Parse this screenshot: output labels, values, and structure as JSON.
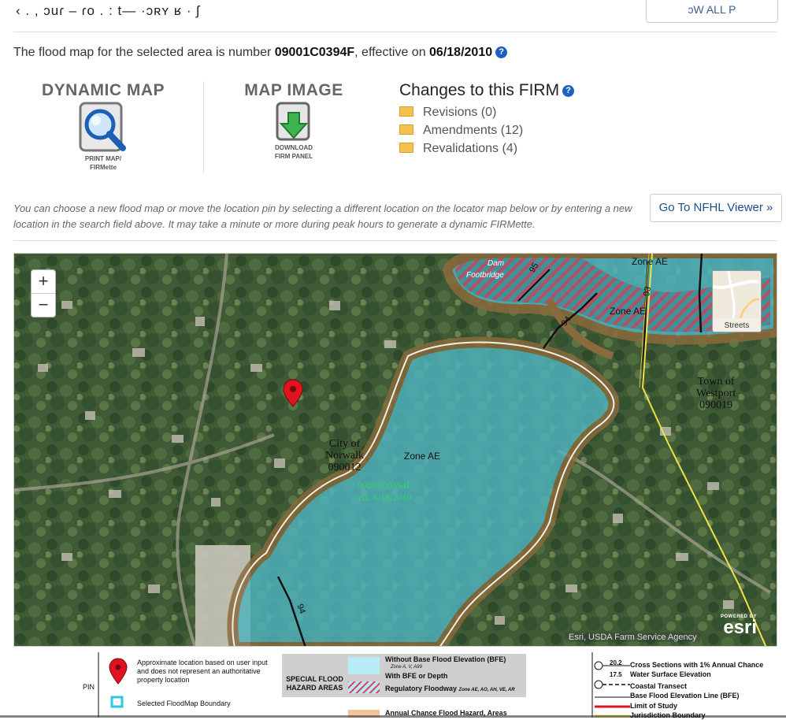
{
  "header": {
    "garbled_text": "‹ . , ɔuɾ ‒ ɾo . : t— ·ɔʀʏ ʁ · ʃ",
    "show_all_label": "ɔW ALL P"
  },
  "intro": {
    "prefix": "The flood map for the selected area is number ",
    "panel_number": "09001C0394F",
    "middle": ", effective on ",
    "effective_date": "06/18/2010",
    "help": "?"
  },
  "tools": {
    "dynamic_map": {
      "title": "DYNAMIC MAP",
      "caption_line1": "PRINT MAP/",
      "caption_line2": "FIRMette",
      "icon": "magnifier-icon"
    },
    "map_image": {
      "title": "MAP IMAGE",
      "caption_line1": "DOWNLOAD",
      "caption_line2": "FIRM PANEL",
      "icon": "download-icon"
    }
  },
  "changes": {
    "title": "Changes to this FIRM",
    "help": "?",
    "items": [
      {
        "label": "Revisions (0)"
      },
      {
        "label": "Amendments (12)"
      },
      {
        "label": "Revalidations (4)"
      }
    ]
  },
  "note": "You can choose a new flood map or move the location pin by selecting a different location on the locator map below or by entering a new location in the search field above. It may take a minute or more during peak hours to generate a dynamic FIRMette.",
  "nfhl_button": "Go To NFHL Viewer »",
  "map": {
    "zoom_in": "+",
    "zoom_out": "−",
    "basemap_label": "Streets",
    "attribution": "Esri, USDA Farm Service Agency",
    "powered_by": "POWERED BY",
    "esri": "esri",
    "labels": {
      "city1": "City of",
      "city2": "Norwalk",
      "city3": "090012",
      "town1": "Town of",
      "town2": "Westport",
      "town3": "090019",
      "panel": "09001C0394F",
      "panel_eff": "eff. 6/18/2010",
      "zone1": "Zone AE",
      "zone2": "Zone AE",
      "zone3": "Zone AE",
      "dam1": "Dam",
      "dam2": "Footbridge",
      "xs1": "94",
      "xs2": "95",
      "xs3": "93",
      "xs4": "94"
    }
  },
  "legend": {
    "pin_label": "PIN",
    "pin_text1": "Approximate location based on user input",
    "pin_text2": "and does not represent an authoritative",
    "pin_text3": "property location",
    "boundary_text": "Selected FloodMap Boundary",
    "sfha1": "SPECIAL FLOOD",
    "sfha2": "HAZARD AREAS",
    "without_bfe": "Without Base Flood Elevation (BFE)",
    "without_bfe_sub": "Zone A, V, A99",
    "with_bfe": "With BFE or Depth",
    "floodway": "Regulatory Floodway",
    "floodway_sub": "Zone AE, AO, AH, VE, AR",
    "annual": "Annual Chance Flood Hazard, Areas",
    "xs_value1": "20.2",
    "xs_value2": "17.5",
    "xs_text1": "Cross Sections with 1% Annual Chance",
    "xs_text2": "Water Surface Elevation",
    "coastal": "Coastal Transect",
    "bfe_line": "Base Flood Elevation Line (BFE)",
    "limit": "Limit of Study",
    "jurisdiction": "Jurisdiction Boundary"
  }
}
